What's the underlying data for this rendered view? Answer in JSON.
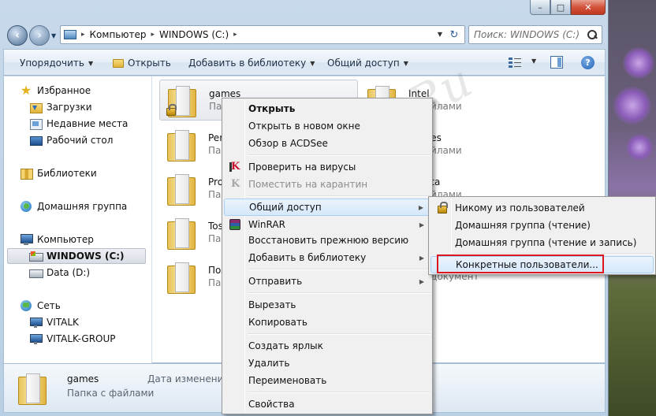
{
  "address": {
    "segments": [
      "Компьютер",
      "WINDOWS (C:)"
    ]
  },
  "search": {
    "placeholder": "Поиск: WINDOWS (C:)"
  },
  "toolbar": {
    "organize": "Упорядочить",
    "open": "Открыть",
    "add_to_library": "Добавить в библиотеку",
    "share": "Общий доступ"
  },
  "sidebar": {
    "favorites": "Избранное",
    "downloads": "Загрузки",
    "recent": "Недавние места",
    "desktop": "Рабочий стол",
    "libraries": "Библиотеки",
    "homegroup": "Домашняя группа",
    "computer": "Компьютер",
    "drive_c": "WINDOWS (C:)",
    "drive_d": "Data (D:)",
    "network": "Сеть",
    "pc1": "VITALK",
    "pc2": "VITALK-GROUP"
  },
  "files": {
    "left": [
      {
        "name": "games",
        "type": "Папка с файлами"
      },
      {
        "name": "Perf",
        "type": "Папк"
      },
      {
        "name": "Prog",
        "type": "Папк"
      },
      {
        "name": "Tosl",
        "type": "Папк"
      },
      {
        "name": "Пол",
        "type": "Папк"
      }
    ],
    "right": [
      {
        "name": "Intel",
        "type": "с файлами"
      },
      {
        "name": "m Files",
        "type": "с файлами"
      },
      {
        "name": "mData",
        "type": "с файлами"
      },
      {
        "name": "",
        "type": ""
      },
      {
        "name": "",
        "type": "вый документ"
      }
    ]
  },
  "details": {
    "name": "games",
    "type": "Папка с файлами",
    "date_label": "Дата изменения:"
  },
  "context_menu": {
    "open": "Открыть",
    "open_new_window": "Открыть в новом окне",
    "acdsee": "Обзор в ACDSee",
    "scan": "Проверить на вирусы",
    "quarantine": "Поместить на карантин",
    "share": "Общий доступ",
    "winrar": "WinRAR",
    "restore": "Восстановить прежнюю версию",
    "add_library": "Добавить в библиотеку",
    "send_to": "Отправить",
    "cut": "Вырезать",
    "copy": "Копировать",
    "shortcut": "Создать ярлык",
    "delete": "Удалить",
    "rename": "Переименовать",
    "properties": "Свойства"
  },
  "submenu": {
    "nobody": "Никому из пользователей",
    "homegroup_read": "Домашняя группа (чтение)",
    "homegroup_rw": "Домашняя группа (чтение и запись)",
    "specific": "Конкретные пользователи..."
  },
  "watermark": "All4os.Ru"
}
